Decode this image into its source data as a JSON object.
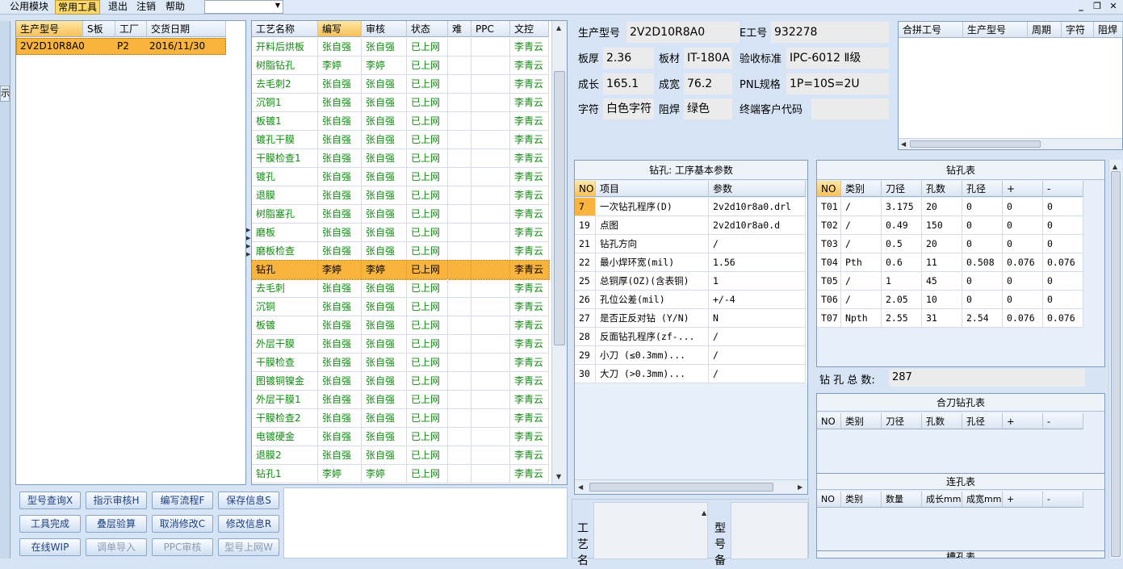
{
  "menu": {
    "items": [
      "公用模块",
      "常用工具",
      "退出",
      "注销",
      "帮助"
    ],
    "active": "常用工具"
  },
  "colors": {
    "accent_row": "#f9b43e",
    "green_text": "#138a13",
    "bg": "#d6e4f5"
  },
  "left_panel": {
    "sidebar_letter": "示",
    "headers": [
      "生产型号",
      "S板",
      "工厂",
      "交货日期"
    ],
    "rows": [
      [
        "2V2D10R8A0",
        "",
        "P2",
        "2016/11/30"
      ]
    ]
  },
  "process_table": {
    "headers": [
      "工艺名称",
      "编写",
      "审核",
      "状态",
      "难",
      "PPC",
      "文控"
    ],
    "rows": [
      [
        "开料后烘板",
        "张自强",
        "张自强",
        "已上网",
        "",
        "",
        "李青云"
      ],
      [
        "树脂钻孔",
        "李婷",
        "李婷",
        "已上网",
        "",
        "",
        "李青云"
      ],
      [
        "去毛刺2",
        "张自强",
        "张自强",
        "已上网",
        "",
        "",
        "李青云"
      ],
      [
        "沉铜1",
        "张自强",
        "张自强",
        "已上网",
        "",
        "",
        "李青云"
      ],
      [
        "板镀1",
        "张自强",
        "张自强",
        "已上网",
        "",
        "",
        "李青云"
      ],
      [
        "镀孔干膜",
        "张自强",
        "张自强",
        "已上网",
        "",
        "",
        "李青云"
      ],
      [
        "干膜检查1",
        "张自强",
        "张自强",
        "已上网",
        "",
        "",
        "李青云"
      ],
      [
        "镀孔",
        "张自强",
        "张自强",
        "已上网",
        "",
        "",
        "李青云"
      ],
      [
        "退膜",
        "张自强",
        "张自强",
        "已上网",
        "",
        "",
        "李青云"
      ],
      [
        "树脂塞孔",
        "张自强",
        "张自强",
        "已上网",
        "",
        "",
        "李青云"
      ],
      [
        "磨板",
        "张自强",
        "张自强",
        "已上网",
        "",
        "",
        "李青云"
      ],
      [
        "磨板检查",
        "张自强",
        "张自强",
        "已上网",
        "",
        "",
        "李青云"
      ],
      [
        "钻孔",
        "李婷",
        "李婷",
        "已上网",
        "",
        "",
        "李青云"
      ],
      [
        "去毛刺",
        "张自强",
        "张自强",
        "已上网",
        "",
        "",
        "李青云"
      ],
      [
        "沉铜",
        "张自强",
        "张自强",
        "已上网",
        "",
        "",
        "李青云"
      ],
      [
        "板镀",
        "张自强",
        "张自强",
        "已上网",
        "",
        "",
        "李青云"
      ],
      [
        "外层干膜",
        "张自强",
        "张自强",
        "已上网",
        "",
        "",
        "李青云"
      ],
      [
        "干膜检查",
        "张自强",
        "张自强",
        "已上网",
        "",
        "",
        "李青云"
      ],
      [
        "图镀铜镍金",
        "张自强",
        "张自强",
        "已上网",
        "",
        "",
        "李青云"
      ],
      [
        "外层干膜1",
        "张自强",
        "张自强",
        "已上网",
        "",
        "",
        "李青云"
      ],
      [
        "干膜检查2",
        "张自强",
        "张自强",
        "已上网",
        "",
        "",
        "李青云"
      ],
      [
        "电镀硬金",
        "张自强",
        "张自强",
        "已上网",
        "",
        "",
        "李青云"
      ],
      [
        "退膜2",
        "张自强",
        "张自强",
        "已上网",
        "",
        "",
        "李青云"
      ],
      [
        "钻孔1",
        "李婷",
        "李婷",
        "已上网",
        "",
        "",
        "李青云"
      ]
    ],
    "selected_index": 12
  },
  "buttons": [
    [
      "型号查询X",
      "指示审核H",
      "编写流程F",
      "保存信息S"
    ],
    [
      "工具完成",
      "叠层验算",
      "取消修改C",
      "修改信息R"
    ],
    [
      "在线WIP",
      "调单导入",
      "PPC审核",
      "型号上网W"
    ]
  ],
  "disabled_buttons": [
    "调单导入",
    "PPC审核",
    "型号上网W"
  ],
  "info": {
    "model_label": "生产型号",
    "model": "2V2D10R8A0",
    "eno_label": "E工号",
    "eno": "932278",
    "thickness_label": "板厚",
    "thickness": "2.36",
    "material_label": "板材",
    "material": "IT-180A",
    "standard_label": "验收标准",
    "standard": "IPC-6012 Ⅱ级",
    "length_label": "成长",
    "length": "165.1",
    "width_label": "成宽",
    "width": "76.2",
    "pnl_label": "PNL规格",
    "pnl": "1P=10S=2U",
    "char_label": "字符",
    "char": "白色字符",
    "mask_label": "阻焊",
    "mask": "绿色",
    "customer_label": "终端客户代码",
    "customer": ""
  },
  "merge_table": {
    "headers": [
      "合拼工号",
      "生产型号",
      "周期",
      "字符",
      "阻焊"
    ]
  },
  "drill_params": {
    "title": "钻孔: 工序基本参数",
    "headers": [
      "NO",
      "项目",
      "参数"
    ],
    "rows": [
      [
        "7",
        "一次钻孔程序(D)",
        "2v2d10r8a0.drl"
      ],
      [
        "19",
        "点图",
        "2v2d10r8a0.d"
      ],
      [
        "21",
        "钻孔方向",
        "/"
      ],
      [
        "22",
        "最小焊环宽(mil)",
        "1.56"
      ],
      [
        "25",
        "总铜厚(OZ)(含表铜)",
        "1"
      ],
      [
        "26",
        "孔位公差(mil)",
        "+/-4"
      ],
      [
        "27",
        "是否正反对钻 (Y/N)",
        "N"
      ],
      [
        "28",
        "反面钻孔程序(zf-...",
        "/"
      ],
      [
        "29",
        "小刀 (≤0.3mm)...",
        "/"
      ],
      [
        "30",
        "大刀 (>0.3mm)...",
        "/"
      ]
    ]
  },
  "drill_table": {
    "title": "钻孔表",
    "headers": [
      "NO",
      "类别",
      "刀径",
      "孔数",
      "孔径",
      "+",
      "-"
    ],
    "rows": [
      [
        "T01",
        "/",
        "3.175",
        "20",
        "0",
        "0",
        "0"
      ],
      [
        "T02",
        "/",
        "0.49",
        "150",
        "0",
        "0",
        "0"
      ],
      [
        "T03",
        "/",
        "0.5",
        "20",
        "0",
        "0",
        "0"
      ],
      [
        "T04",
        "Pth",
        "0.6",
        "11",
        "0.508",
        "0.076",
        "0.076"
      ],
      [
        "T05",
        "/",
        "1",
        "45",
        "0",
        "0",
        "0"
      ],
      [
        "T06",
        "/",
        "2.05",
        "10",
        "0",
        "0",
        "0"
      ],
      [
        "T07",
        "Npth",
        "2.55",
        "31",
        "2.54",
        "0.076",
        "0.076"
      ]
    ],
    "total_label": "钻 孔 总 数:",
    "total": "287"
  },
  "combo_drill": {
    "title": "合刀钻孔表",
    "headers": [
      "NO",
      "类别",
      "刀径",
      "孔数",
      "孔径",
      "+",
      "-"
    ]
  },
  "link_hole": {
    "title": "连孔表",
    "headers": [
      "NO",
      "类别",
      "数量",
      "成长mm",
      "成宽mm",
      "+",
      "-"
    ]
  },
  "slot_hole": {
    "title": "槽孔表"
  },
  "bottom_labels": {
    "left": "工艺名",
    "right": "型号备"
  }
}
